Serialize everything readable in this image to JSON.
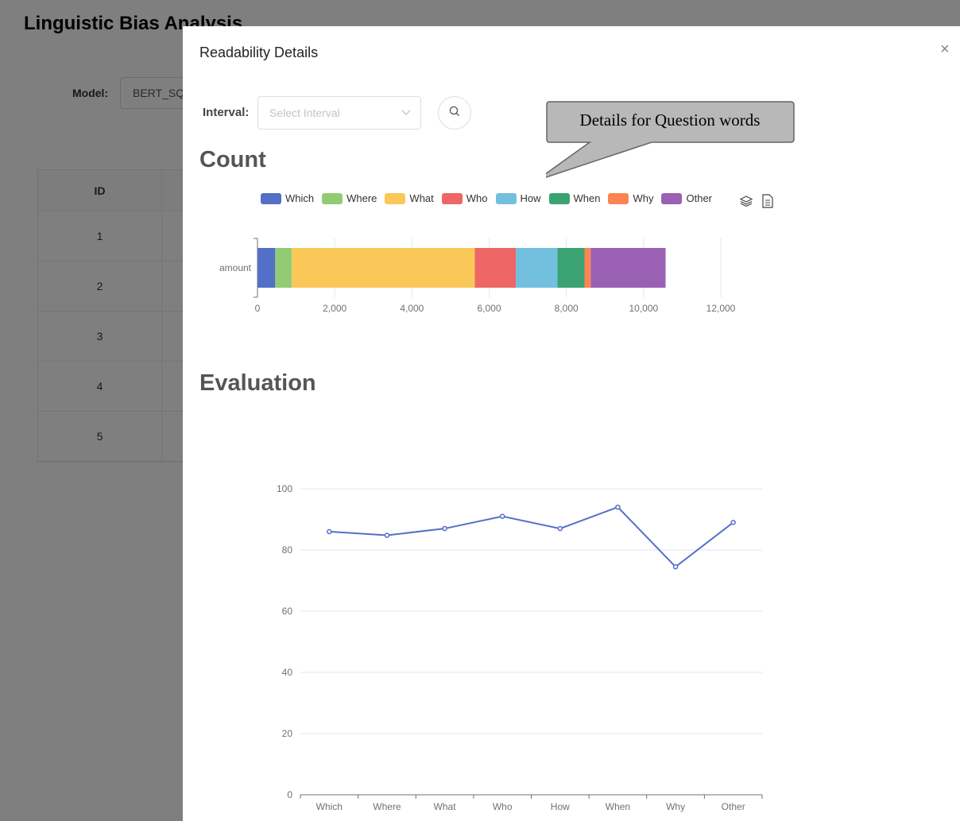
{
  "background": {
    "title": "Linguistic Bias Analysis",
    "model_label": "Model:",
    "model_value": "BERT_SQ",
    "table": {
      "header_id": "ID",
      "rows": [
        "1",
        "2",
        "3",
        "4",
        "5"
      ]
    }
  },
  "modal": {
    "title": "Readability Details",
    "close_icon": "×",
    "interval_label": "Interval:",
    "interval_placeholder": "Select Interval",
    "callout_text": "Details for Question words",
    "count_title": "Count",
    "evaluation_title": "Evaluation"
  },
  "colors": {
    "Which": "#5470c6",
    "Where": "#91cc75",
    "What": "#fac858",
    "Who": "#ee6666",
    "How": "#73c0de",
    "When": "#3ba272",
    "Why": "#fc8452",
    "Other": "#9a60b4"
  },
  "chart_data": [
    {
      "type": "bar",
      "orientation": "horizontal-stacked",
      "categories": [
        "amount"
      ],
      "series": [
        {
          "name": "Which",
          "values": [
            460
          ]
        },
        {
          "name": "Where",
          "values": [
            430
          ]
        },
        {
          "name": "What",
          "values": [
            4740
          ]
        },
        {
          "name": "Who",
          "values": [
            1060
          ]
        },
        {
          "name": "How",
          "values": [
            1080
          ]
        },
        {
          "name": "When",
          "values": [
            700
          ]
        },
        {
          "name": "Why",
          "values": [
            160
          ]
        },
        {
          "name": "Other",
          "values": [
            1940
          ]
        }
      ],
      "xlim": [
        0,
        12000
      ],
      "xticks": [
        "0",
        "2,000",
        "4,000",
        "6,000",
        "8,000",
        "10,000",
        "12,000"
      ],
      "legend": "top"
    },
    {
      "type": "line",
      "categories": [
        "Which",
        "Where",
        "What",
        "Who",
        "How",
        "When",
        "Why",
        "Other"
      ],
      "series": [
        {
          "values": [
            86,
            84.8,
            87,
            91,
            87,
            94,
            74.5,
            89
          ]
        }
      ],
      "ylim": [
        0,
        100
      ],
      "yticks": [
        "0",
        "20",
        "40",
        "60",
        "80",
        "100"
      ],
      "grid": true
    }
  ]
}
